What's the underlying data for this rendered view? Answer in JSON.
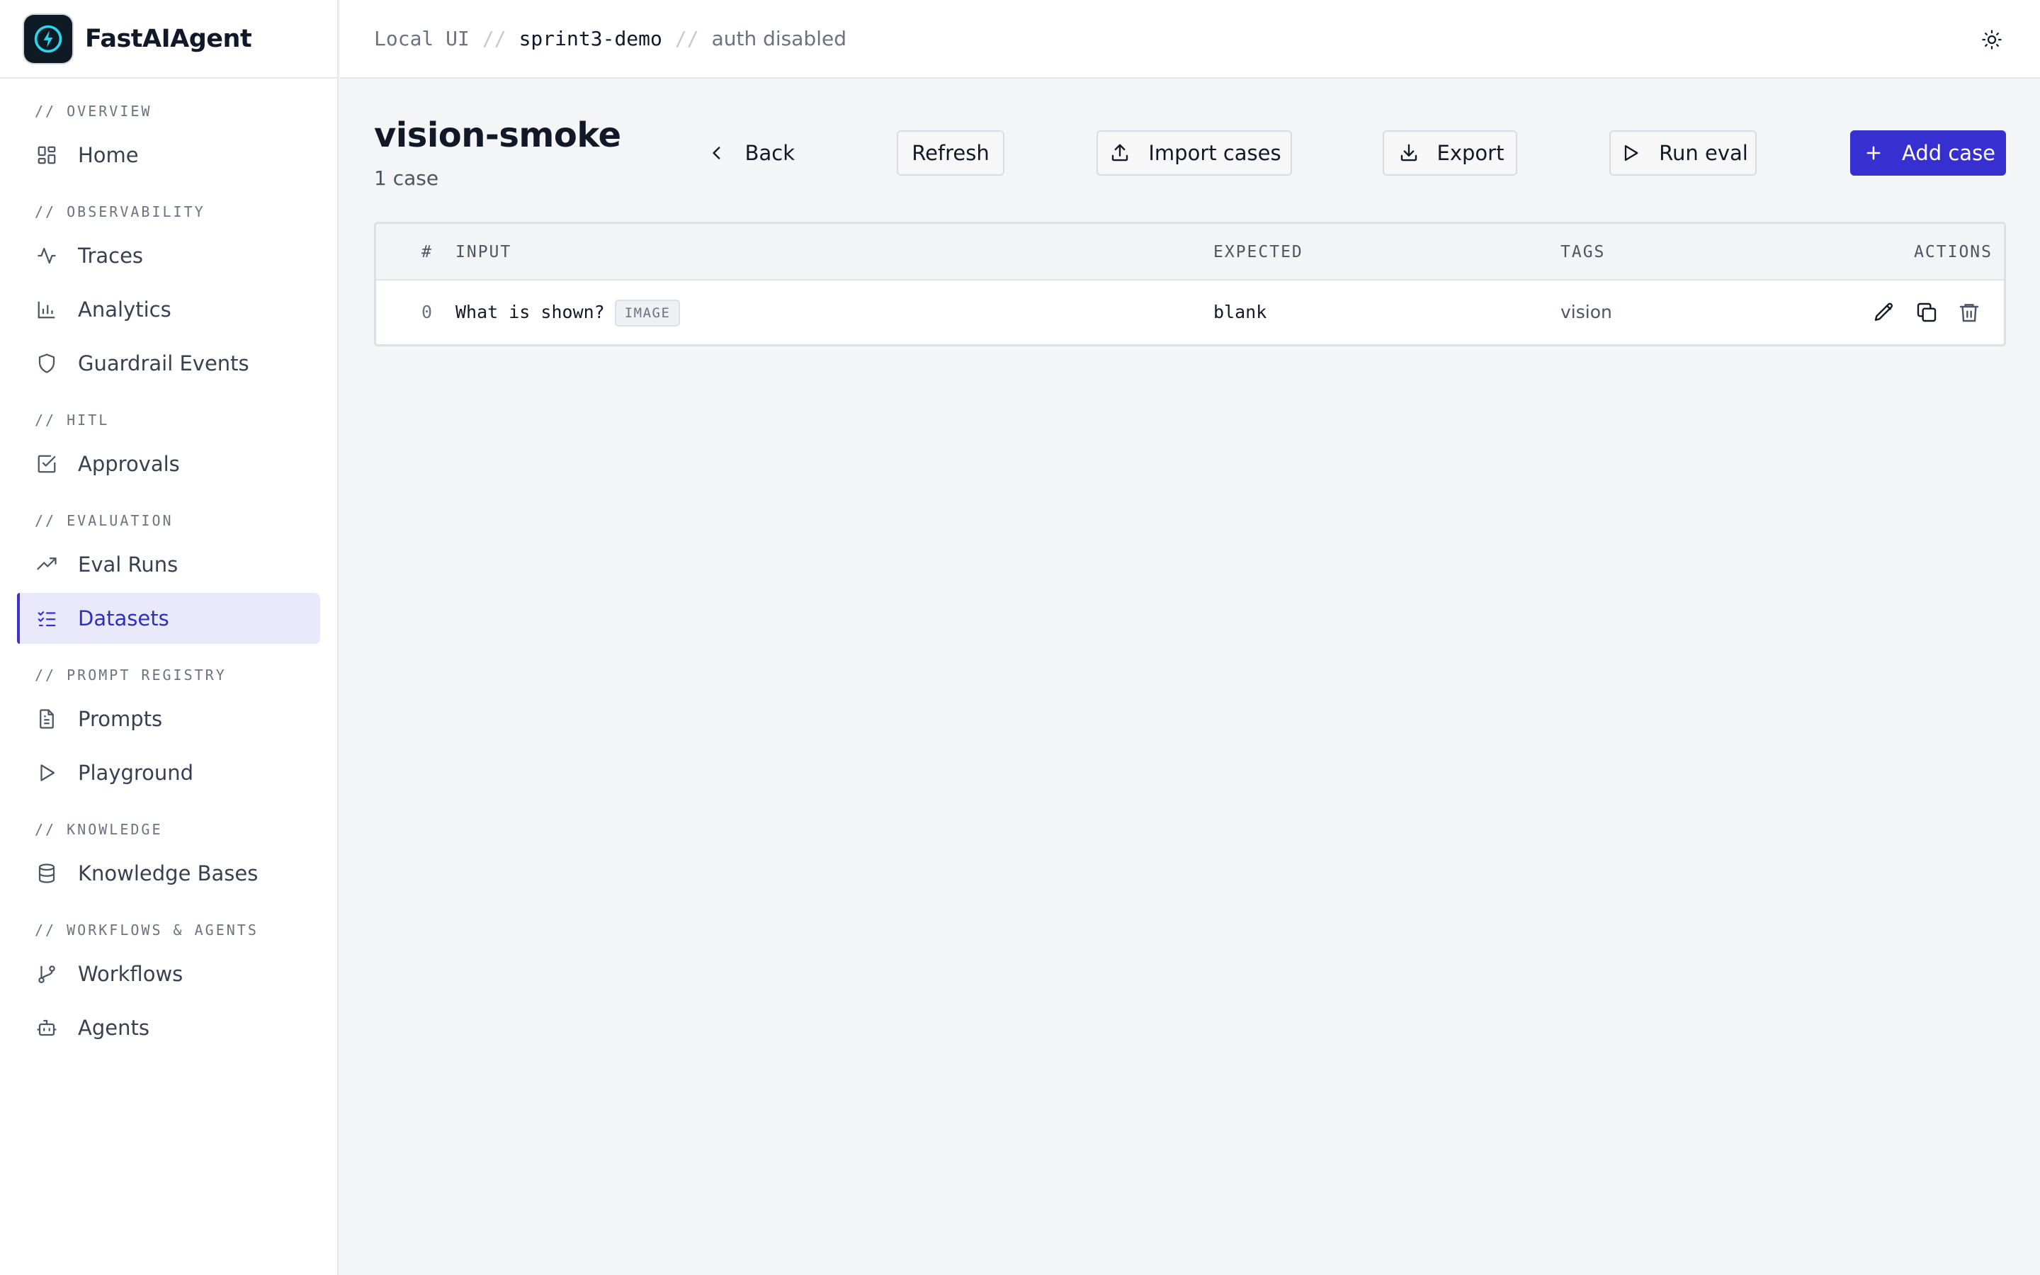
{
  "app": {
    "name": "FastAIAgent"
  },
  "breadcrumb": {
    "root": "Local UI",
    "project": "sprint3-demo",
    "auth": "auth disabled",
    "separator": "//"
  },
  "sidebar": {
    "sections": [
      {
        "label": "// OVERVIEW",
        "items": [
          {
            "label": "Home",
            "icon": "grid-icon"
          }
        ]
      },
      {
        "label": "// OBSERVABILITY",
        "items": [
          {
            "label": "Traces",
            "icon": "activity-icon"
          },
          {
            "label": "Analytics",
            "icon": "bar-chart-icon"
          },
          {
            "label": "Guardrail Events",
            "icon": "shield-icon"
          }
        ]
      },
      {
        "label": "// HITL",
        "items": [
          {
            "label": "Approvals",
            "icon": "check-square-icon"
          }
        ]
      },
      {
        "label": "// EVALUATION",
        "items": [
          {
            "label": "Eval Runs",
            "icon": "trending-up-icon"
          },
          {
            "label": "Datasets",
            "icon": "list-checks-icon",
            "active": true
          }
        ]
      },
      {
        "label": "// PROMPT REGISTRY",
        "items": [
          {
            "label": "Prompts",
            "icon": "file-text-icon"
          },
          {
            "label": "Playground",
            "icon": "play-icon"
          }
        ]
      },
      {
        "label": "// KNOWLEDGE",
        "items": [
          {
            "label": "Knowledge Bases",
            "icon": "database-icon"
          }
        ]
      },
      {
        "label": "// WORKFLOWS & AGENTS",
        "items": [
          {
            "label": "Workflows",
            "icon": "git-branch-icon"
          },
          {
            "label": "Agents",
            "icon": "bot-icon"
          }
        ]
      }
    ]
  },
  "page": {
    "title": "vision-smoke",
    "subtitle": "1 case",
    "buttons": {
      "back": "Back",
      "refresh": "Refresh",
      "import": "Import cases",
      "export": "Export",
      "run": "Run eval",
      "add": "Add case"
    }
  },
  "table": {
    "columns": {
      "index": "#",
      "input": "INPUT",
      "expected": "EXPECTED",
      "tags": "TAGS",
      "actions": "ACTIONS"
    },
    "rows": [
      {
        "index": "0",
        "input": "What is shown?",
        "badge": "IMAGE",
        "expected": "blank",
        "tags": "vision"
      }
    ]
  },
  "colors": {
    "accent": "#3730d1",
    "active_bg": "#e9e9fb",
    "active_text": "#2f2fbf"
  }
}
